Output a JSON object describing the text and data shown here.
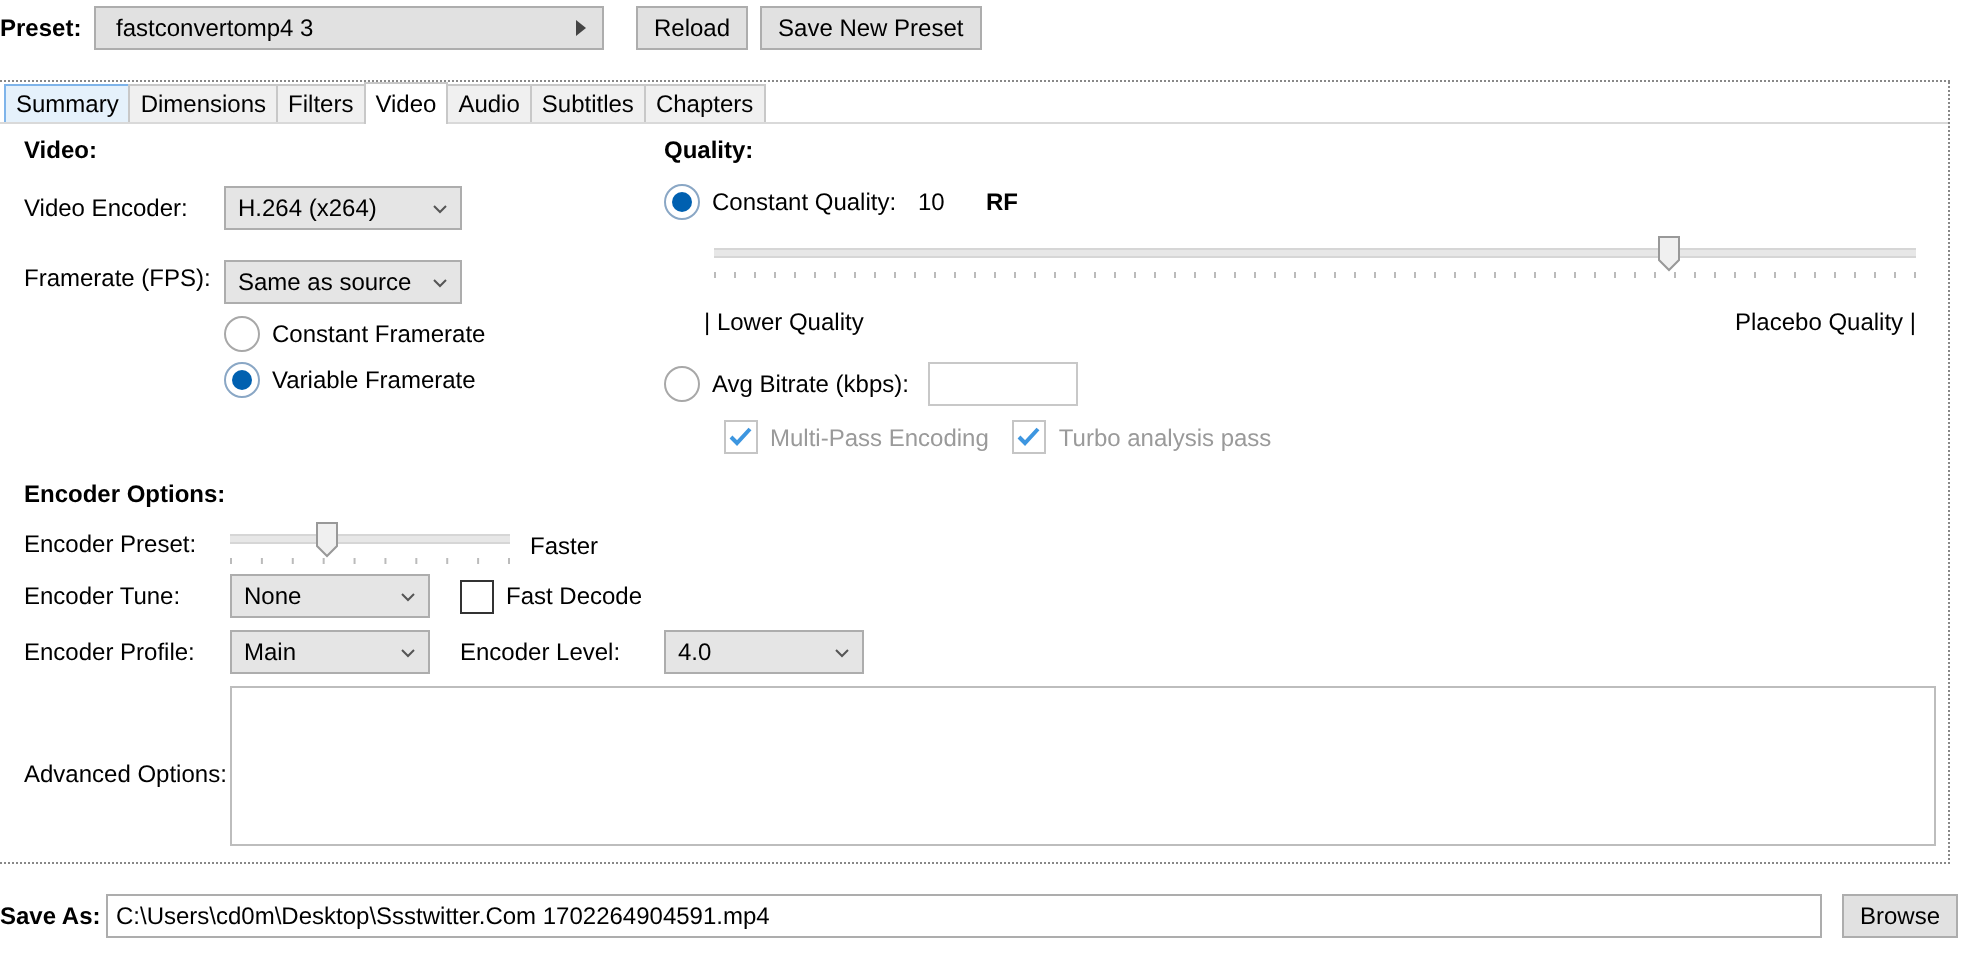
{
  "preset": {
    "label": "Preset:",
    "value": "fastconvertomp4 3"
  },
  "buttons": [
    "Reload",
    "Save New Preset"
  ],
  "tabs": [
    {
      "label": "Summary",
      "selected": false,
      "highlighted": true
    },
    {
      "label": "Dimensions",
      "selected": false,
      "highlighted": false
    },
    {
      "label": "Filters",
      "selected": false,
      "highlighted": false
    },
    {
      "label": "Video",
      "selected": true,
      "highlighted": false
    },
    {
      "label": "Audio",
      "selected": false,
      "highlighted": false
    },
    {
      "label": "Subtitles",
      "selected": false,
      "highlighted": false
    },
    {
      "label": "Chapters",
      "selected": false,
      "highlighted": false
    }
  ],
  "video": {
    "heading": "Video:",
    "encoder": {
      "label": "Video Encoder:",
      "value": "H.264 (x264)"
    },
    "framerate": {
      "label": "Framerate (FPS):",
      "value": "Same as source"
    },
    "framerate_modes": [
      {
        "label": "Constant Framerate",
        "selected": false
      },
      {
        "label": "Variable Framerate",
        "selected": true
      }
    ]
  },
  "quality": {
    "heading": "Quality:",
    "constant": {
      "label": "Constant Quality:",
      "selected": true,
      "value": "10",
      "unit": "RF"
    },
    "slider": {
      "level": 0.8
    },
    "lower_label": "| Lower Quality",
    "upper_label": "Placebo Quality |",
    "bitrate": {
      "label": "Avg Bitrate (kbps):",
      "selected": false
    },
    "passes": [
      {
        "label": "Multi-Pass Encoding",
        "checked": true,
        "disabled": true
      },
      {
        "label": "Turbo analysis pass",
        "checked": true,
        "disabled": true
      }
    ]
  },
  "encoder_options": {
    "heading": "Encoder Options:",
    "preset": {
      "label": "Encoder Preset:",
      "level": 0.33,
      "value": "Faster"
    },
    "tune": {
      "label": "Encoder Tune:",
      "value": "None"
    },
    "fast_decode": {
      "label": "Fast Decode",
      "checked": false
    },
    "profile": {
      "label": "Encoder Profile:",
      "value": "Main"
    },
    "level": {
      "label": "Encoder Level:",
      "value": "4.0"
    },
    "advanced": {
      "label": "Advanced Options:"
    }
  },
  "save_as": {
    "label": "Save As:",
    "value": "C:\\Users\\cd0m\\Desktop\\Ssstwitter.Com 1702264904591.mp4",
    "button": "Browse"
  }
}
